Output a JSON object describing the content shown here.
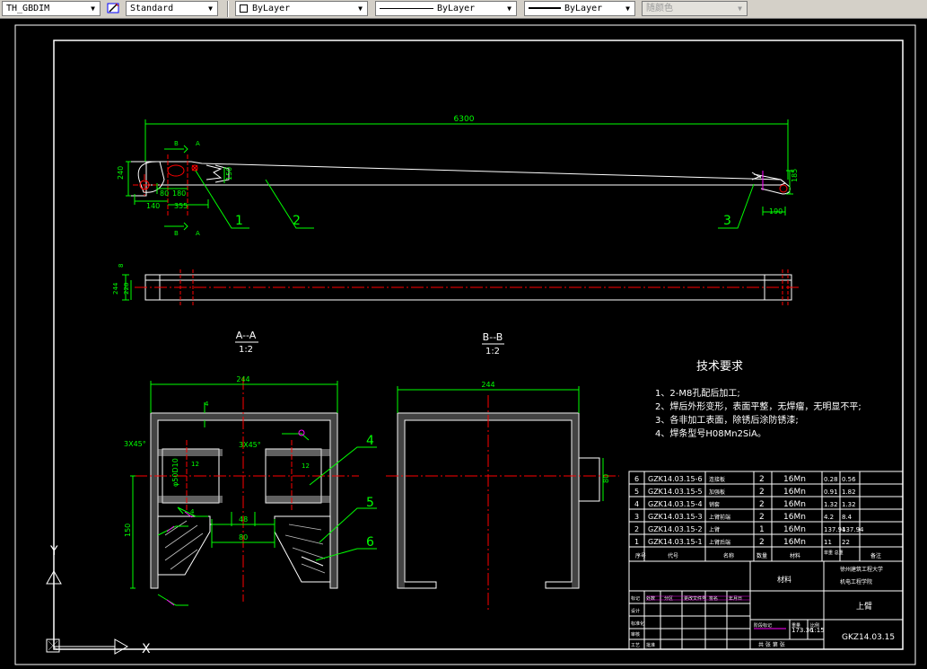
{
  "toolbar": {
    "dimstyle": "TH_GBDIM",
    "textstyle": "Standard",
    "layer": "ByLayer",
    "linetype": "ByLayer",
    "lineweight": "ByLayer",
    "plotstyle": "随颜色",
    "dropdown_icon": "chevron-down-icon",
    "textstyle_icon": "text-style-icon"
  },
  "drawing": {
    "dims": {
      "overall": "6300",
      "h240": "240",
      "w80": "80",
      "w180": "180",
      "w140": "140",
      "w355": "355",
      "d150": "150",
      "d185": "185",
      "d190": "190",
      "side8": "8",
      "side244": "244",
      "side228": "228",
      "aa244": "244",
      "aa4": "4",
      "aa3x45a": "3X45°",
      "aa3x45b": "3X45°",
      "aaphi": "φ50D10",
      "aa12a": "12",
      "aa12b": "12",
      "aa48": "48",
      "aa80": "80",
      "aa150": "150",
      "bb244": "244",
      "bb80": "80",
      "weld": "4"
    },
    "section_marks": {
      "b1": "B",
      "a1": "A",
      "b2": "B",
      "a2": "A"
    },
    "balloons": {
      "p1": "1",
      "p2": "2",
      "p3": "3",
      "p4": "4",
      "p5": "5",
      "p6": "6"
    },
    "view_aa": {
      "title": "A--A",
      "scale": "1:2"
    },
    "view_bb": {
      "title": "B--B",
      "scale": "1:2"
    },
    "tech": {
      "title": "技术要求",
      "items": [
        "1、2-M8孔配后加工;",
        "2、焊后外形变形，表面平整，无焊瘤，无明显不平;",
        "3、各非加工表面，除锈后涂防锈漆;",
        "4、焊条型号H08Mn2SiA。"
      ]
    },
    "bom": [
      {
        "seq": "6",
        "code": "GZK14.03.15-6",
        "name": "连接板",
        "qty": "2",
        "mat": "16Mn",
        "unit": "0.28",
        "total": "0.56"
      },
      {
        "seq": "5",
        "code": "GZK14.03.15-5",
        "name": "加强板",
        "qty": "2",
        "mat": "16Mn",
        "unit": "0.91",
        "total": "1.82"
      },
      {
        "seq": "4",
        "code": "GZK14.03.15-4",
        "name": "销套",
        "qty": "2",
        "mat": "16Mn",
        "unit": "1.32",
        "total": "1.32"
      },
      {
        "seq": "3",
        "code": "GZK14.03.15-3",
        "name": "上臂前端",
        "qty": "2",
        "mat": "16Mn",
        "unit": "4.2",
        "total": "8.4"
      },
      {
        "seq": "2",
        "code": "GZK14.03.15-2",
        "name": "上臂",
        "qty": "1",
        "mat": "16Mn",
        "unit": "137.94",
        "total": "137.94"
      },
      {
        "seq": "1",
        "code": "GZK14.03.15-1",
        "name": "上臂后端",
        "qty": "2",
        "mat": "16Mn",
        "unit": "11",
        "total": "22"
      }
    ],
    "bom_header": {
      "seq": "序号",
      "code": "代号",
      "name": "名称",
      "qty": "数量",
      "mat": "材料",
      "weight": "单重 总重",
      "note": "备注"
    },
    "title_block": {
      "material": "材料",
      "school": "徐州建筑工程大学",
      "dept": "机电工程学院",
      "part_name": "上臂",
      "weight": "173.36",
      "scale": "1:15",
      "drawing_no": "GKZ14.03.15",
      "sheet": "共 张 第 张",
      "labels": [
        "标记",
        "处数",
        "分区",
        "更改文件号",
        "签名",
        "年月日",
        "设计",
        "标准化",
        "审核",
        "工艺",
        "批准",
        "阶段标记",
        "重量",
        "比例"
      ]
    },
    "ucs": {
      "x": "X",
      "y": "Y"
    },
    "colors": {
      "white": "#ffffff",
      "green": "#00ff00",
      "red": "#ff0000",
      "magenta": "#ff00ff",
      "cyan": "#00ffff",
      "hatch": "#c0c0c0"
    }
  }
}
